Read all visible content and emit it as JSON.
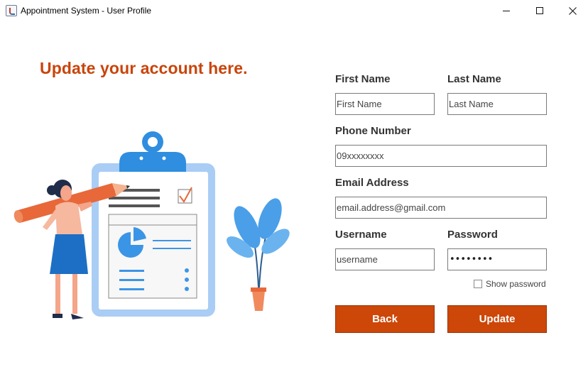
{
  "window": {
    "title": "Appointment System - User Profile",
    "controls": [
      "minimize",
      "maximize",
      "close"
    ]
  },
  "heading": "Update your account here.",
  "form": {
    "first_name": {
      "label": "First Name",
      "placeholder": "First Name"
    },
    "last_name": {
      "label": "Last Name",
      "placeholder": "Last Name"
    },
    "phone": {
      "label": "Phone Number",
      "placeholder": "09xxxxxxxx"
    },
    "email": {
      "label": "Email Address",
      "placeholder": "email.address@gmail.com"
    },
    "username": {
      "label": "Username",
      "placeholder": "username"
    },
    "password": {
      "label": "Password",
      "masked_value": "••••••••"
    },
    "show_password": {
      "label": "Show password",
      "checked": false
    }
  },
  "buttons": {
    "back": "Back",
    "update": "Update"
  },
  "colors": {
    "accent": "#cc4708",
    "heading": "#c9440a",
    "illustration_blue": "#4a9fe8",
    "illustration_orange": "#e8683a"
  },
  "icons": [
    "app-java-icon",
    "minimize-icon",
    "maximize-icon",
    "close-icon"
  ]
}
